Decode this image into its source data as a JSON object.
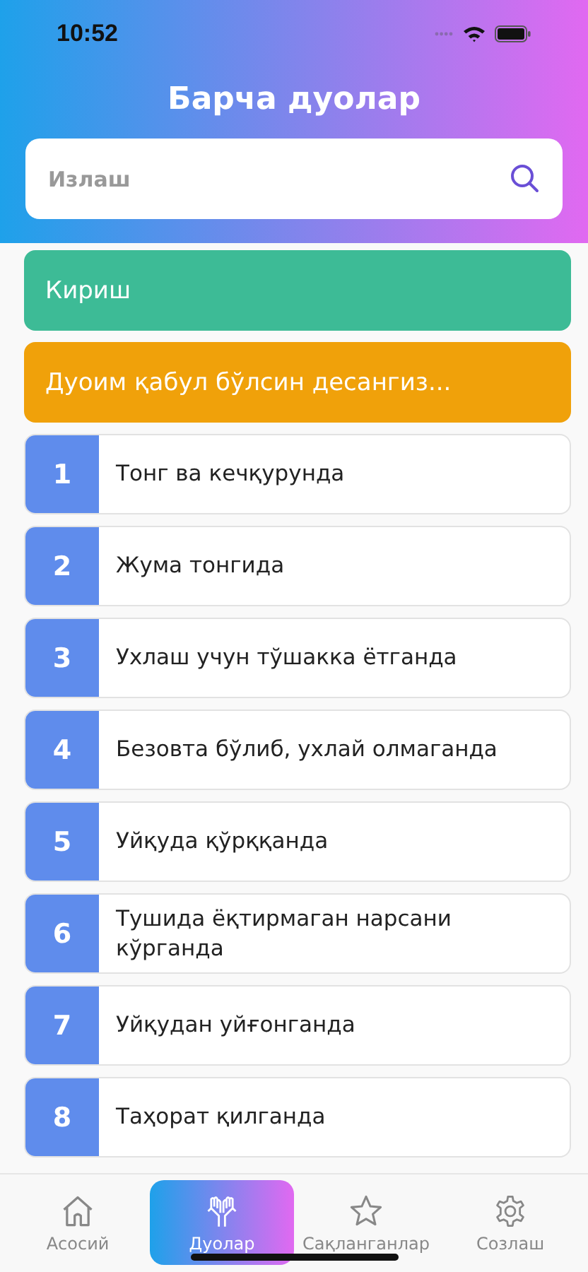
{
  "status_bar": {
    "time": "10:52"
  },
  "header": {
    "title": "Барча дуолар"
  },
  "search": {
    "placeholder": "Излаш"
  },
  "sections": [
    {
      "label": "Кириш",
      "color": "#3dbb96"
    },
    {
      "label": "Дуоим қабул бўлсин десангиз...",
      "color": "#f0a10a"
    }
  ],
  "duas": [
    {
      "number": "1",
      "title": "Тонг ва кечқурунда"
    },
    {
      "number": "2",
      "title": "Жума тонгида"
    },
    {
      "number": "3",
      "title": "Ухлаш учун тўшакка ётганда"
    },
    {
      "number": "4",
      "title": "Безовта бўлиб, ухлай олмаганда"
    },
    {
      "number": "5",
      "title": "Уйқуда қўрққанда"
    },
    {
      "number": "6",
      "title": "Тушида ёқтирмаган нарсани кўрганда"
    },
    {
      "number": "7",
      "title": "Уйқудан уйғонганда"
    },
    {
      "number": "8",
      "title": "Таҳорат қилганда"
    }
  ],
  "tabs": [
    {
      "label": "Асосий",
      "selected": false
    },
    {
      "label": "Дуолар",
      "selected": true
    },
    {
      "label": "Сақланганлар",
      "selected": false
    },
    {
      "label": "Созлаш",
      "selected": false
    }
  ]
}
